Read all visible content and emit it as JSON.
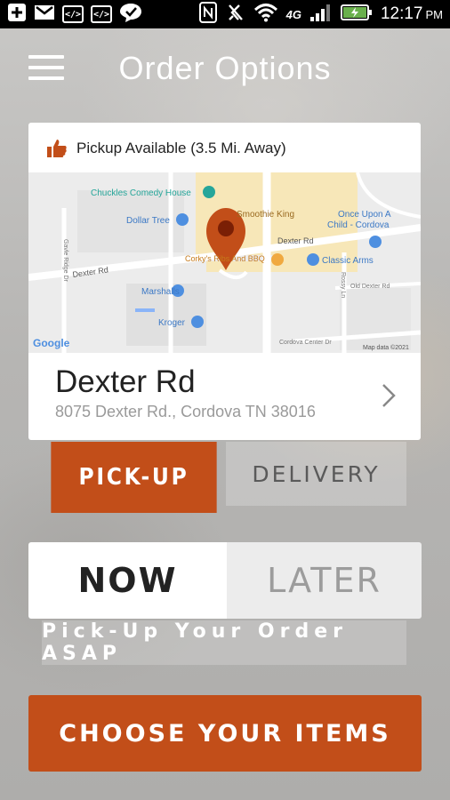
{
  "status_bar": {
    "time": "12:17",
    "ampm": "PM",
    "network": "4G",
    "icons": [
      "plus-box-icon",
      "gmail-icon",
      "code-icon",
      "code-icon",
      "chat-check-icon",
      "nfc-icon",
      "mute-icon",
      "wifi-icon",
      "signal-icon",
      "battery-icon"
    ]
  },
  "header": {
    "title": "Order Options",
    "menu_icon": "hamburger-menu-icon"
  },
  "location_card": {
    "availability": "Pickup Available (3.5 Mi. Away)",
    "availability_icon": "thumbs-up-icon",
    "map": {
      "labels": {
        "comedy": "Chuckles Comedy House",
        "dollar_tree": "Dollar Tree",
        "smoothie": "Smoothie King",
        "child": "Once Upon A",
        "child2": "Child - Cordova",
        "dexter_rd_right": "Dexter Rd",
        "dexter_rd_left": "Dexter Rd",
        "corkys": "Corky's Ribs And BBQ",
        "classic": "Classic Arms",
        "marshalls": "Marshalls",
        "kroger": "Kroger",
        "gavle": "Gavle Ridge Dr",
        "rivermeadow": "Rossy Ln",
        "old_dexter": "Old Dexter Rd",
        "cordova_center": "Cordova Center Dr",
        "google": "Google",
        "copyright": "Map data ©2021"
      }
    },
    "name": "Dexter Rd",
    "address": "8075 Dexter Rd., Cordova TN 38016",
    "chevron_icon": "chevron-right-icon"
  },
  "order_type": {
    "selected": "pickup",
    "pickup_label": "PICK-UP",
    "delivery_label": "DELIVERY"
  },
  "timing": {
    "selected": "now",
    "now_label": "NOW",
    "later_label": "LATER",
    "note": "Pick-Up Your Order ASAP"
  },
  "cta": {
    "label": "CHOOSE YOUR ITEMS"
  },
  "colors": {
    "accent": "#c24e19",
    "status_bar": "#000000",
    "card": "#ffffff",
    "map_bg": "#ececec",
    "map_commercial": "#f7e7b8"
  }
}
